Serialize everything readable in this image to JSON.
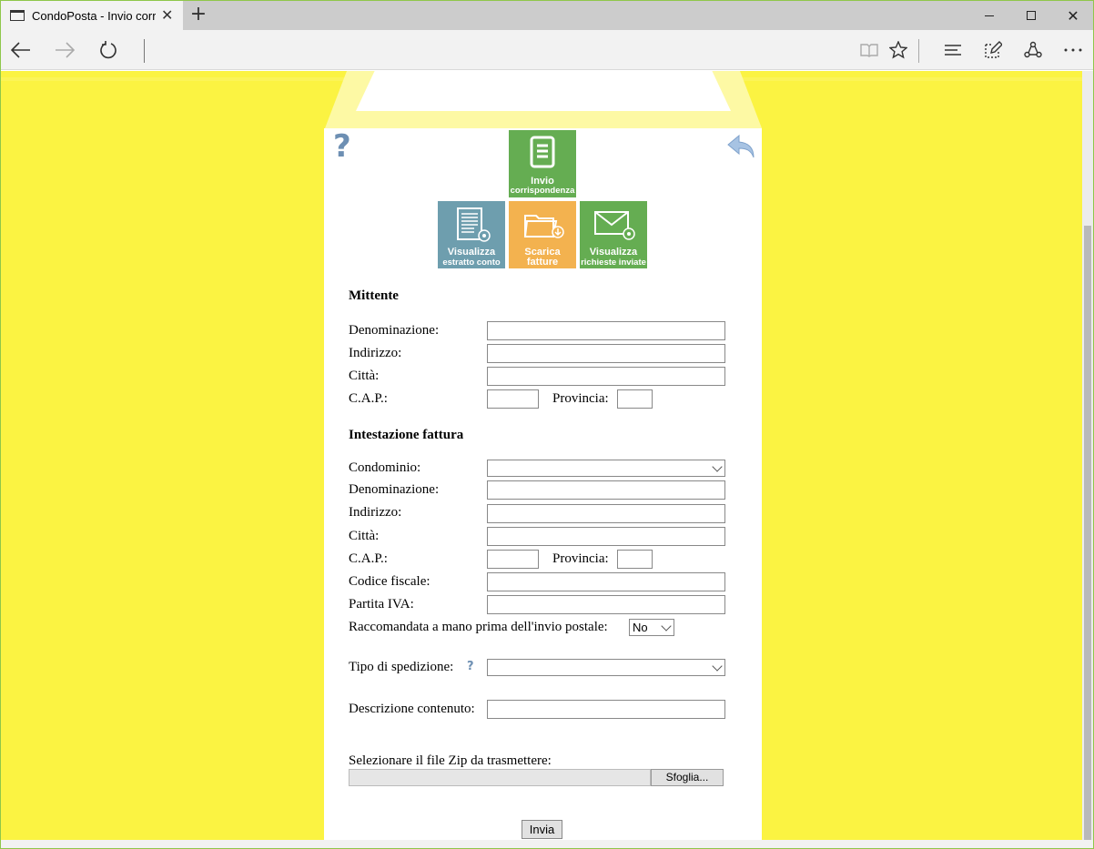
{
  "browser": {
    "tab_title": "CondoPosta - Invio corr",
    "tab_close": "✕",
    "new_tab": "+",
    "window_close": "✕",
    "icons": [
      "back-icon",
      "forward-icon",
      "refresh-icon",
      "reading-view-icon",
      "favorite-star-icon",
      "hub-icon",
      "web-note-icon",
      "share-icon",
      "more-icon"
    ]
  },
  "page": {
    "help_symbol": "?",
    "tiles": [
      {
        "line1": "Invio",
        "line2": "corrispondenza",
        "color": "#65ad52"
      },
      {
        "line1": "Visualizza",
        "line2": "estratto conto",
        "color": "#6e9eae"
      },
      {
        "line1": "Scarica",
        "line2": "fatture",
        "color": "#f3b24f"
      },
      {
        "line1": "Visualizza",
        "line2": "richieste inviate",
        "color": "#65ad52"
      }
    ],
    "mittente": {
      "title": "Mittente",
      "denominazione": "Denominazione:",
      "indirizzo": "Indirizzo:",
      "citta": "Città:",
      "cap": "C.A.P.:",
      "provincia": "Provincia:"
    },
    "fattura": {
      "title": "Intestazione fattura",
      "condominio": "Condominio:",
      "denominazione": "Denominazione:",
      "indirizzo": "Indirizzo:",
      "citta": "Città:",
      "cap": "C.A.P.:",
      "provincia": "Provincia:",
      "codice_fiscale": "Codice fiscale:",
      "partita_iva": "Partita IVA:",
      "raccomandata": "Raccomandata a mano prima dell'invio postale:",
      "raccomandata_value": "No"
    },
    "spedizione": {
      "label": "Tipo di spedizione:",
      "help": "?"
    },
    "descrizione": {
      "label": "Descrizione contenuto:"
    },
    "file": {
      "label": "Selezionare il file Zip da trasmettere:",
      "browse": "Sfoglia..."
    },
    "submit": "Invia",
    "colors": {
      "background": "#fbf342",
      "help_blue": "#6d8fb3"
    }
  }
}
